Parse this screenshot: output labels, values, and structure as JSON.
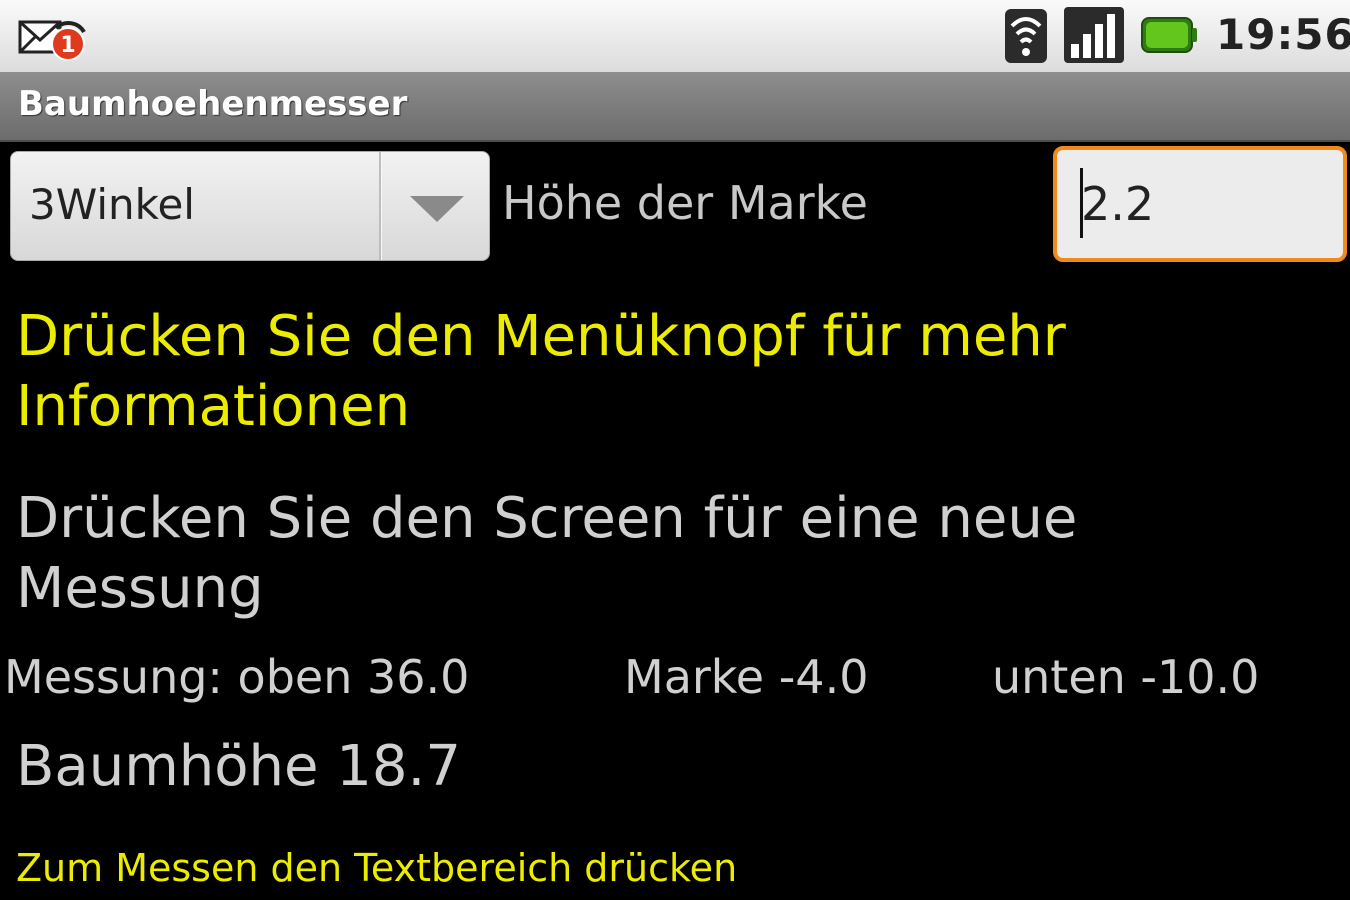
{
  "status_bar": {
    "notification_count": "1",
    "time": "19:56",
    "icons": [
      "mail-notification-icon",
      "wifi-icon",
      "signal-icon",
      "battery-icon"
    ],
    "battery_color": "#5fbf1a"
  },
  "app": {
    "title": "Baumhoehenmesser"
  },
  "spinner": {
    "selected": "3Winkel"
  },
  "marke": {
    "label": "Höhe der Marke",
    "value": "2.2",
    "focus_color": "#f08a1c"
  },
  "hints": {
    "menu": "Drücken Sie den Menüknopf für mehr Informationen",
    "screen": "Drücken Sie den Screen für eine neue Messung",
    "measure": "Zum Messen den Textbereich drücken",
    "highlight_color": "#ecec00"
  },
  "measurement": {
    "oben": "Messung: oben 36.0",
    "marke": "Marke -4.0",
    "unten": "unten -10.0"
  },
  "result": {
    "tree_height": "Baumhöhe 18.7"
  }
}
